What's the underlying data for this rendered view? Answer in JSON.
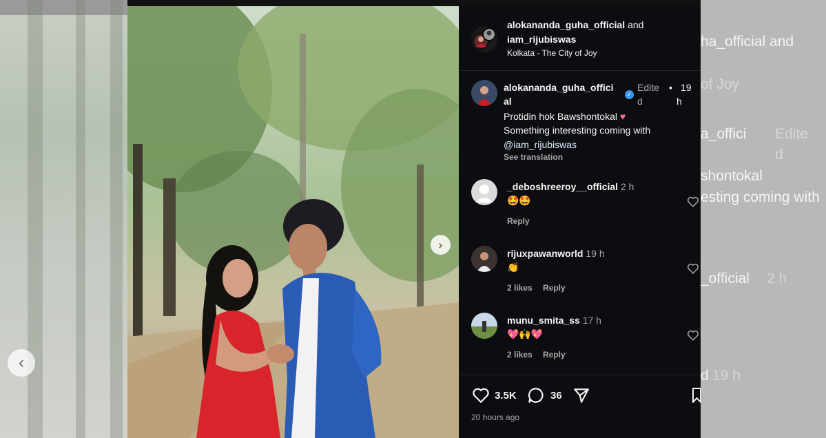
{
  "header": {
    "user1": "alokananda_guha_official",
    "and": "and",
    "user2": "iam_rijubiswas",
    "location": "Kolkata - The City of Joy"
  },
  "caption": {
    "username_line1": "alokananda_guha_offici",
    "username_line2": "al",
    "edited_line1": "Edite",
    "edited_line2": "d",
    "dot": "•",
    "time_line1": "19",
    "time_line2": "h",
    "line1": "Protidin hok Bawshontokal",
    "line2": "Something interesting coming with",
    "mention": "@iam_rijubiswas",
    "see_translation": "See translation"
  },
  "comments": [
    {
      "username": "_deboshreeroy__official",
      "time": "2 h",
      "emoji": "🤩🤩",
      "likes": "",
      "reply": "Reply"
    },
    {
      "username": "rijuxpawanworld",
      "time": "19 h",
      "emoji": "👏",
      "likes": "2 likes",
      "reply": "Reply"
    },
    {
      "username": "munu_smita_ss",
      "time": "17 h",
      "emoji": "💖🙌💖",
      "likes": "2 likes",
      "reply": "Reply"
    }
  ],
  "actions": {
    "likes_count": "3.5K",
    "comments_count": "36",
    "posted": "20 hours ago"
  },
  "background_right": {
    "l1": "ha_official and",
    "l2": "of Joy",
    "l3": "a_offici",
    "l4": "Edite",
    "l5": "d",
    "l6": "shontokal",
    "l7": "esting coming with",
    "l8": "_official",
    "l9": "2 h",
    "l10": "d",
    "l11": "19 h"
  },
  "colors": {
    "accent": "#3897f0",
    "heart": "#ff3b6b",
    "panel_bg": "#0c0d10"
  }
}
